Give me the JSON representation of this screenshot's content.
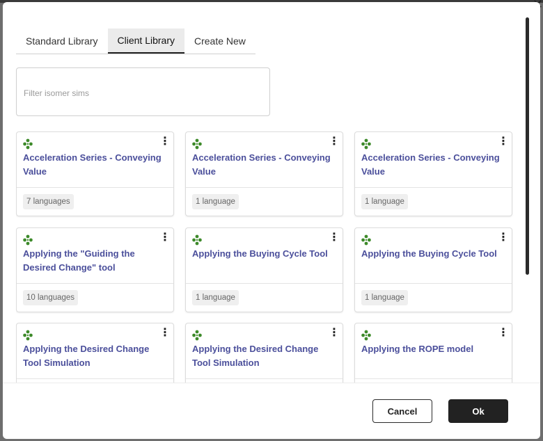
{
  "tabs": [
    {
      "label": "Standard Library",
      "active": false
    },
    {
      "label": "Client Library",
      "active": true
    },
    {
      "label": "Create New",
      "active": false
    }
  ],
  "filter": {
    "placeholder": "Filter isomer sims",
    "value": ""
  },
  "cards": [
    {
      "title": "Acceleration Series - Conveying Value",
      "languages": "7 languages"
    },
    {
      "title": "Acceleration Series - Conveying Value",
      "languages": "1 language"
    },
    {
      "title": "Acceleration Series - Conveying Value",
      "languages": "1 language"
    },
    {
      "title": "Applying the \"Guiding the Desired Change\" tool",
      "languages": "10 languages"
    },
    {
      "title": "Applying the Buying Cycle Tool",
      "languages": "1 language"
    },
    {
      "title": "Applying the Buying Cycle Tool",
      "languages": "1 language"
    },
    {
      "title": "Applying the Desired Change Tool Simulation",
      "languages": ""
    },
    {
      "title": "Applying the Desired Change Tool Simulation",
      "languages": ""
    },
    {
      "title": "Applying the ROPE model",
      "languages": ""
    }
  ],
  "icons": {
    "sim": "sim-node-icon",
    "menu": "kebab-menu-icon",
    "close": "close-icon"
  },
  "colors": {
    "title": "#4b4f9b",
    "icon": "#3d8a2a",
    "ok_bg": "#222222"
  },
  "footer": {
    "cancel_label": "Cancel",
    "ok_label": "Ok"
  }
}
